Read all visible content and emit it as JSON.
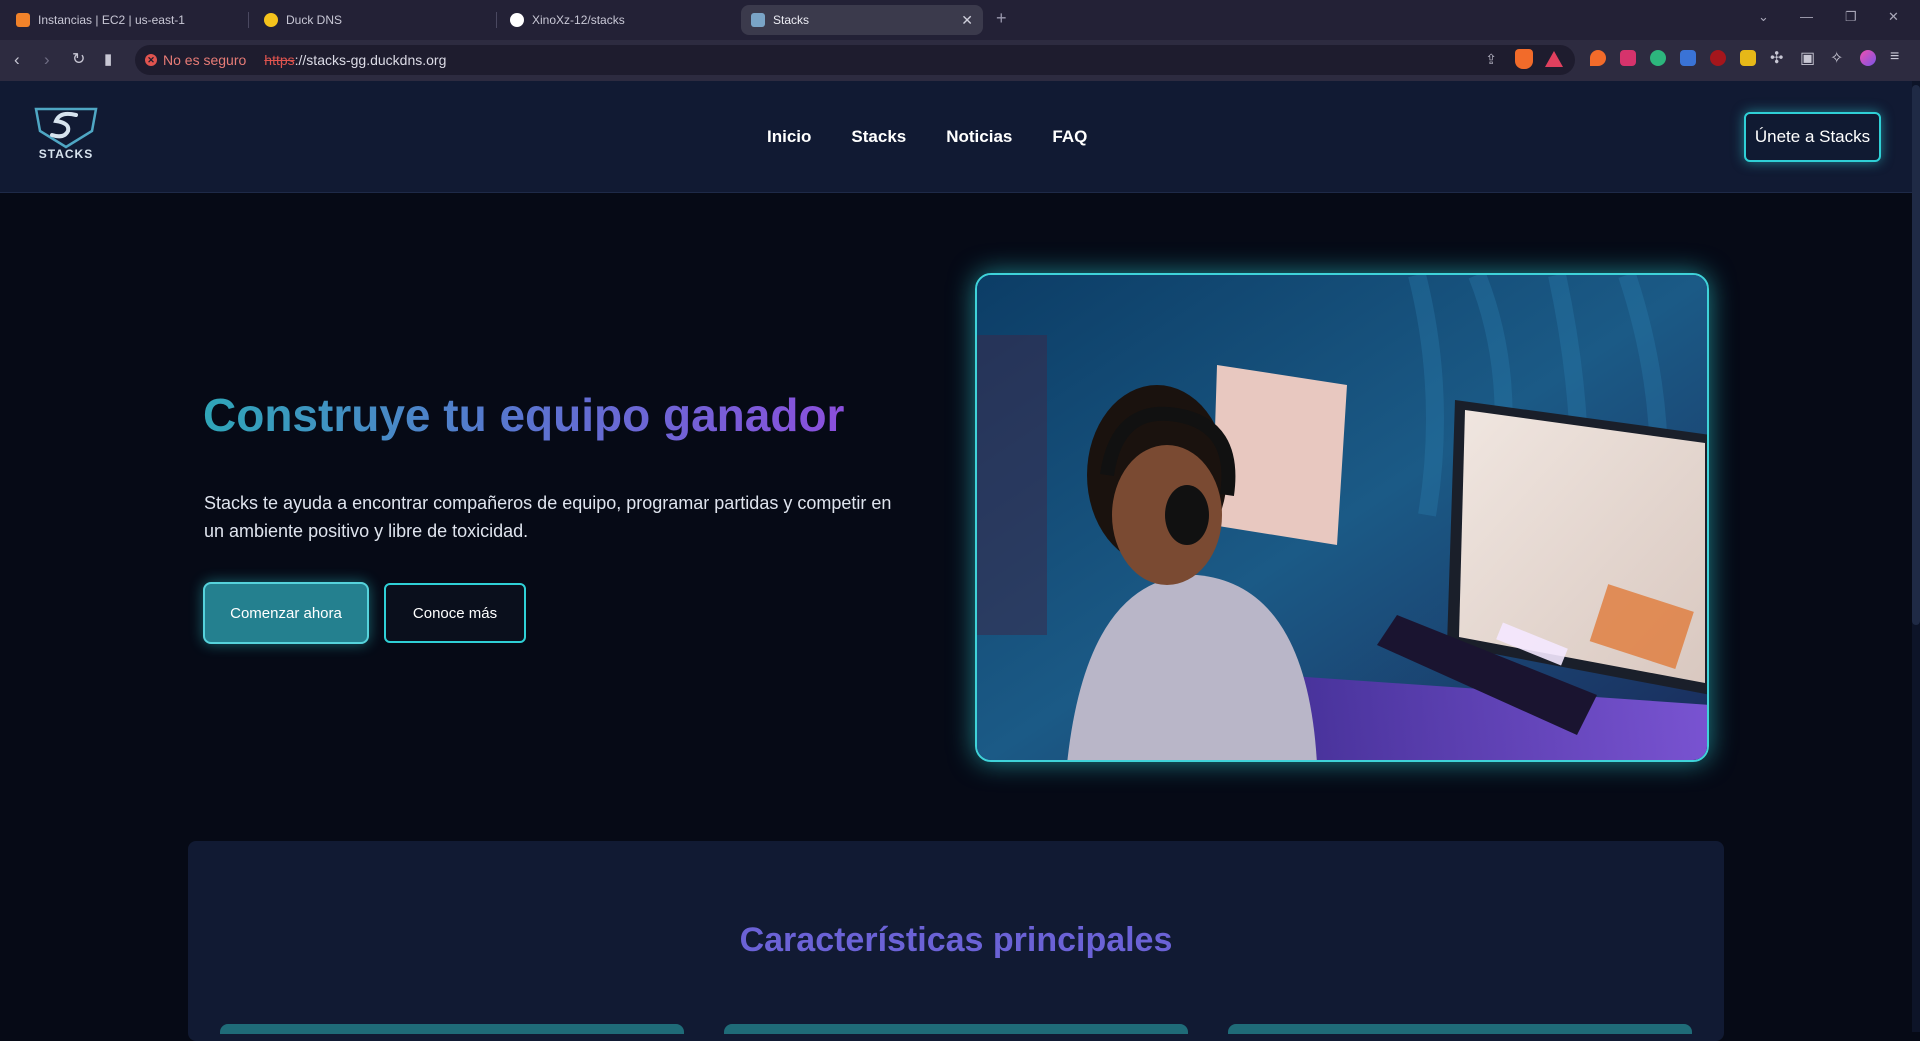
{
  "browser": {
    "tabs": [
      {
        "title": "Instancias | EC2 | us-east-1",
        "favicon_color": "#f0822a"
      },
      {
        "title": "Duck DNS",
        "favicon_color": "#f5c31c"
      },
      {
        "title": "XinoXz-12/stacks",
        "favicon_color": "#ffffff"
      },
      {
        "title": "Stacks",
        "favicon_color": "#7aa4c6",
        "active": true
      }
    ],
    "security_text": "No es seguro",
    "url_scheme": "https",
    "url_rest": "://stacks-gg.duckdns.org"
  },
  "header": {
    "logo_text": "STACKS",
    "nav": [
      "Inicio",
      "Stacks",
      "Noticias",
      "FAQ"
    ],
    "cta": "Únete a Stacks"
  },
  "hero": {
    "title": "Construye tu equipo ganador",
    "description": "Stacks te ayuda a encontrar compañeros de equipo, programar partidas y competir en un ambiente positivo y libre de toxicidad.",
    "primary_button": "Comenzar ahora",
    "secondary_button": "Conoce más"
  },
  "features": {
    "title": "Características principales"
  },
  "colors": {
    "accent": "#2fd0d6",
    "header_bg": "#111a33",
    "page_bg": "#060a16",
    "title_gradient_start": "#2fa6b8",
    "title_gradient_end": "#8b4fdc"
  }
}
